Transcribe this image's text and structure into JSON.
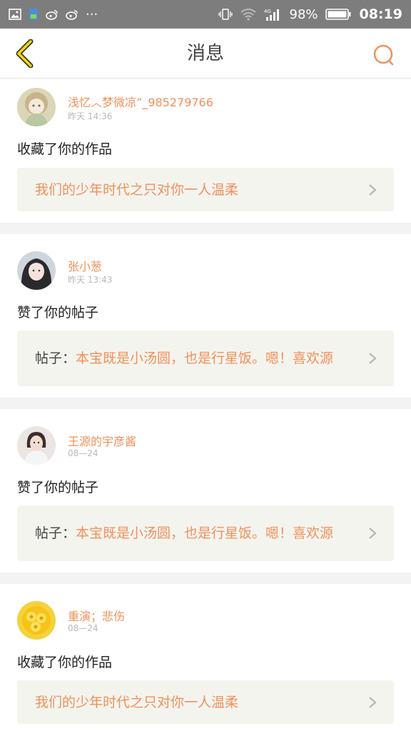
{
  "status_bar": {
    "icons_left": [
      "image-icon",
      "app-badge-icon",
      "weibo-icon",
      "weibo-icon",
      "more-icon"
    ],
    "more": "···",
    "battery": "98%",
    "time": "08:19"
  },
  "header": {
    "title": "消息",
    "back_icon": "back-chevron-icon",
    "search_icon": "search-icon",
    "accent_color": "#f0915a"
  },
  "notifications": [
    {
      "user": "浅忆︿梦微凉”_985279766",
      "time": "昨天 14:36",
      "action": "收藏了你的作品",
      "ref_prefix": "",
      "ref_text": "我们的少年时代之只对你一人温柔"
    },
    {
      "user": "张小葱",
      "time": "昨天 13:43",
      "action": "赞了你的帖子",
      "ref_prefix": "帖子：",
      "ref_text": "本宝既是小汤圆，也是行星饭。嗯！喜欢源"
    },
    {
      "user": "王源的宇彦酱",
      "time": "08—24",
      "action": "赞了你的帖子",
      "ref_prefix": "帖子：",
      "ref_text": "本宝既是小汤圆，也是行星饭。嗯！喜欢源"
    },
    {
      "user": "重演；悲伤",
      "time": "08—24",
      "action": "收藏了你的作品",
      "ref_prefix": "",
      "ref_text": "我们的少年时代之只对你一人温柔"
    }
  ]
}
